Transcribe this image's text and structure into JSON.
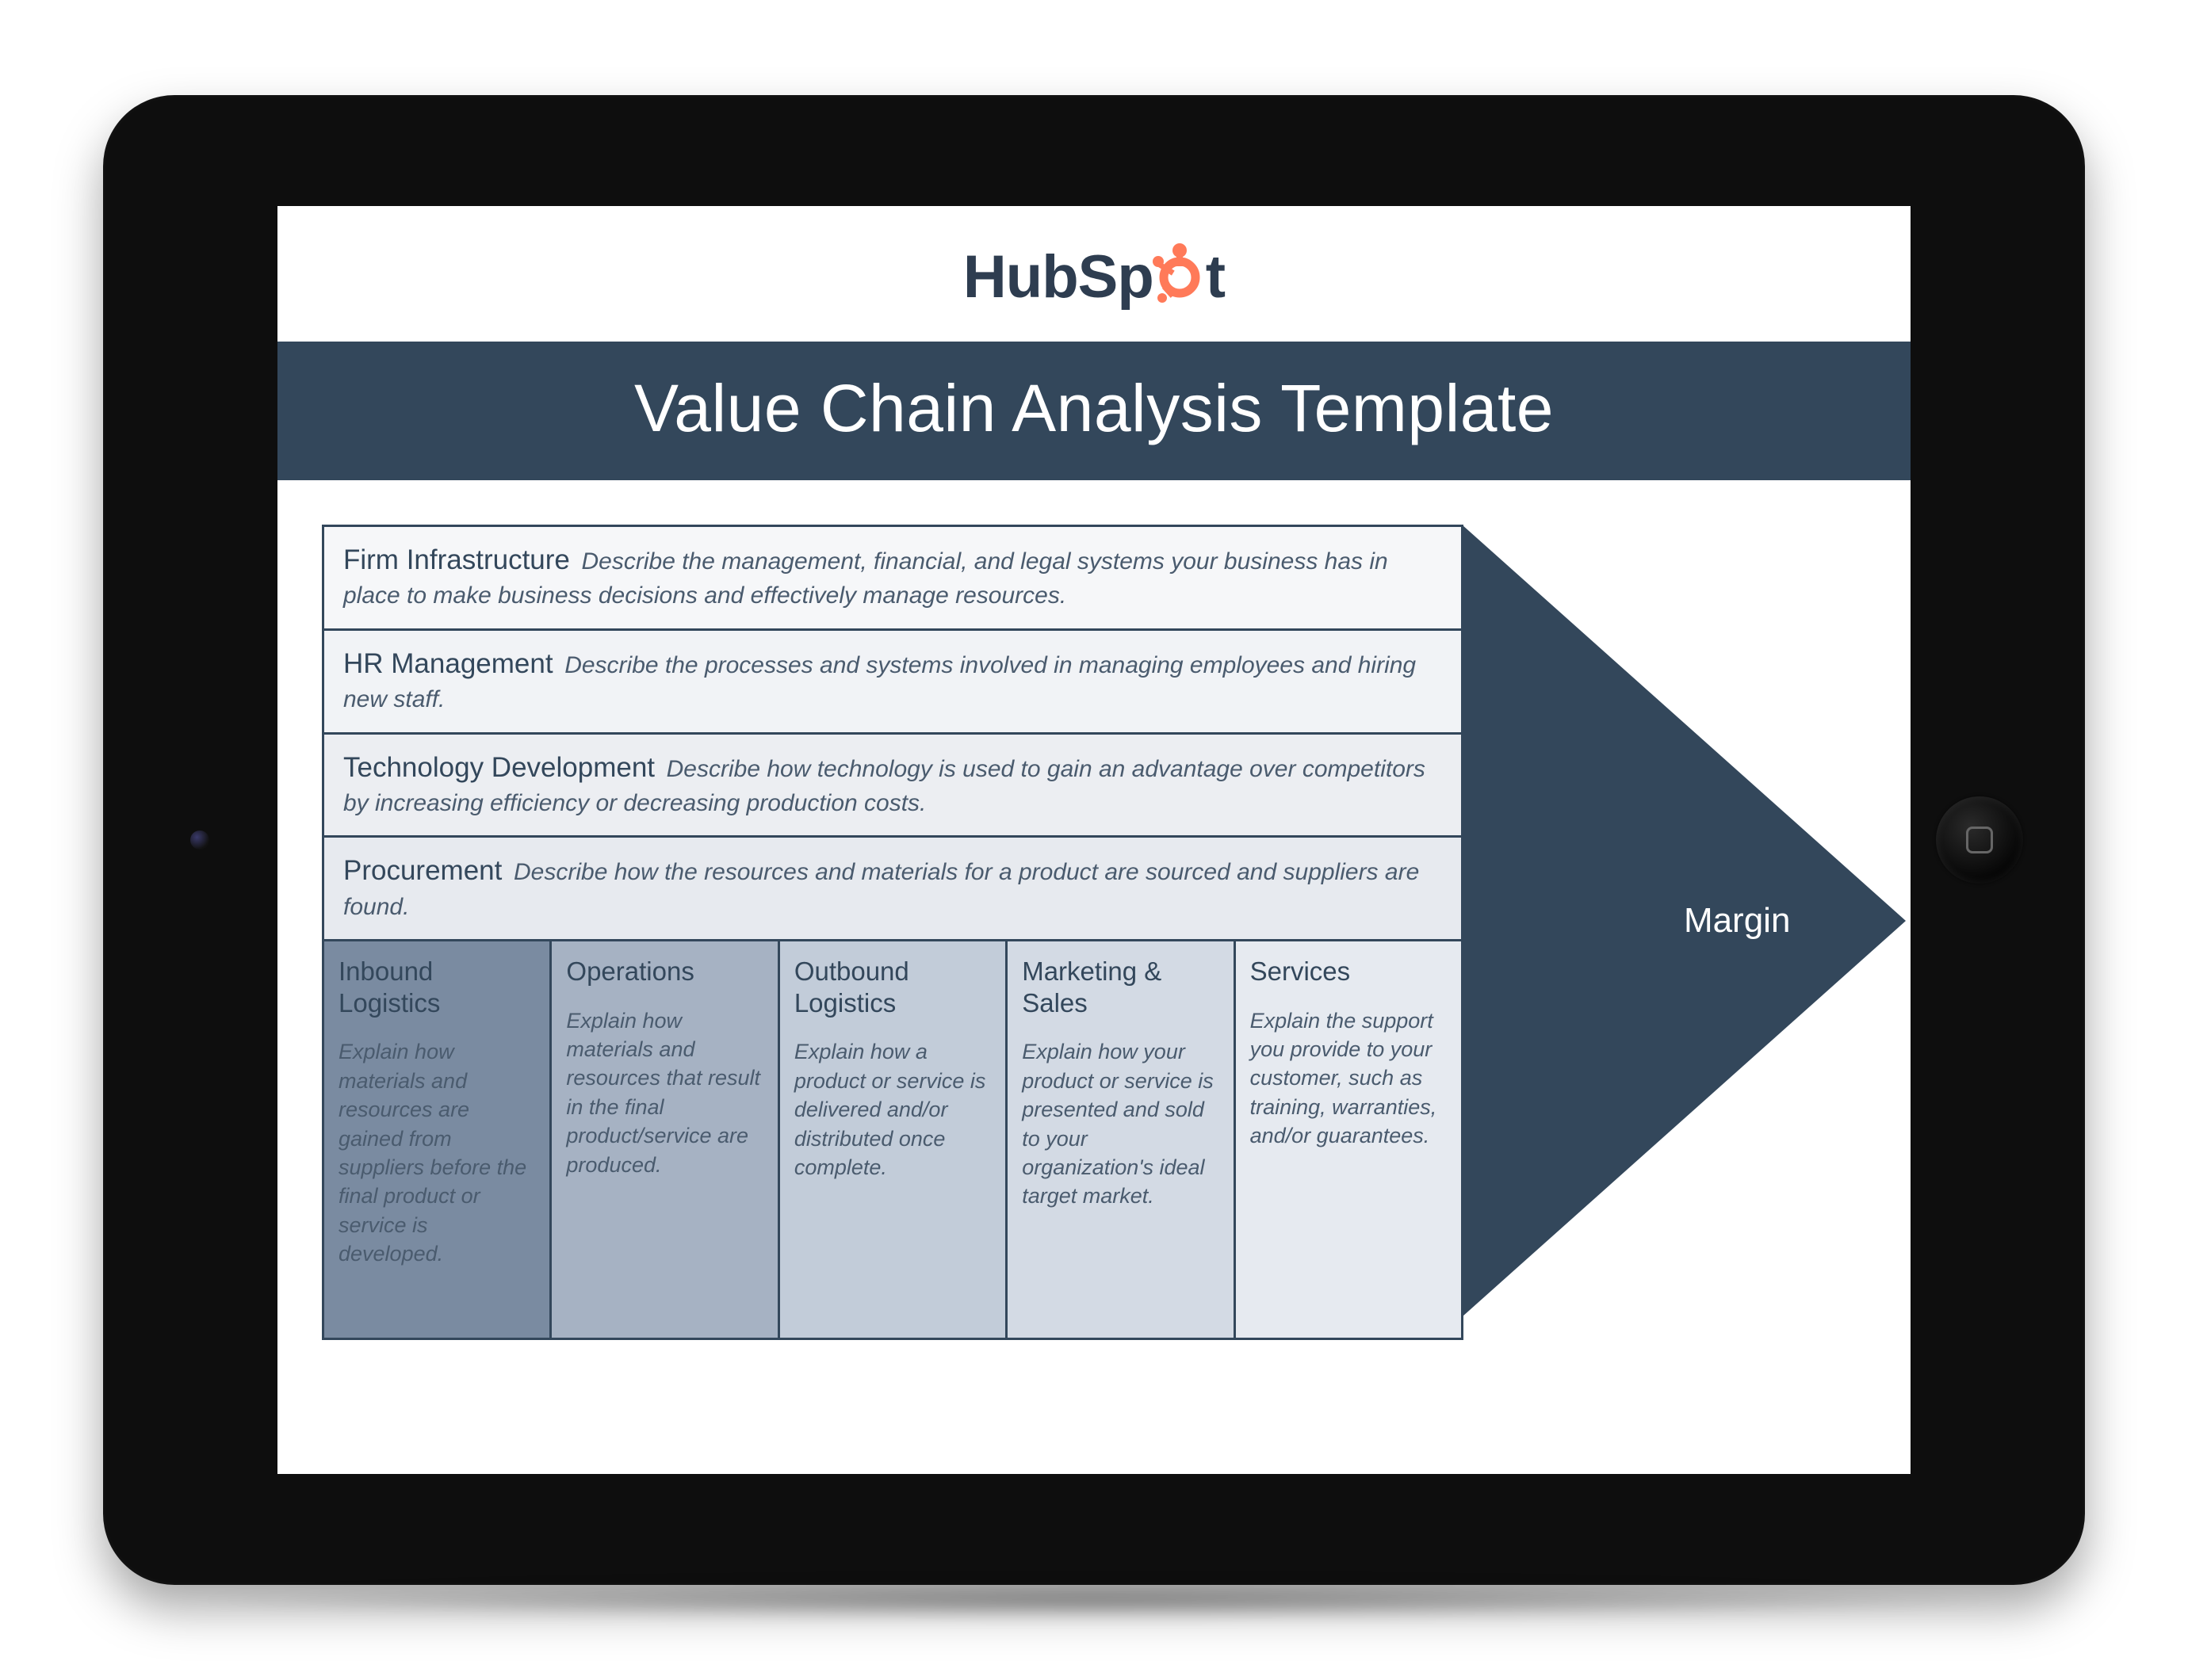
{
  "brand": {
    "name_pre": "HubSp",
    "name_post": "t",
    "accent_color": "#ff7a59",
    "text_color": "#2e3d50"
  },
  "title": "Value Chain Analysis Template",
  "colors": {
    "bar": "#33475b",
    "arrow": "#33475b"
  },
  "margin_label": "Margin",
  "support_activities": [
    {
      "label": "Firm Infrastructure",
      "description": "Describe the management, financial, and legal systems your business has in place to make business decisions and effectively manage resources."
    },
    {
      "label": "HR Management",
      "description": "Describe the processes and systems involved in managing employees and hiring new staff."
    },
    {
      "label": "Technology Development",
      "description": "Describe how technology is used to gain an advantage over competitors by increasing efficiency or decreasing production costs."
    },
    {
      "label": "Procurement",
      "description": "Describe how the resources and materials for a product are sourced and suppliers are found."
    }
  ],
  "primary_activities": [
    {
      "label": "Inbound Logistics",
      "description": "Explain how materials and resources are gained from suppliers before the final product or service is developed."
    },
    {
      "label": "Operations",
      "description": "Explain how materials and resources that result in the final product/service are produced."
    },
    {
      "label": "Outbound Logistics",
      "description": "Explain how a product or service is delivered and/or distributed once complete."
    },
    {
      "label": "Marketing & Sales",
      "description": "Explain how your product or service is presented and sold to your organization's ideal target market."
    },
    {
      "label": "Services",
      "description": "Explain the support you provide to your customer, such as training, warranties, and/or guarantees."
    }
  ]
}
